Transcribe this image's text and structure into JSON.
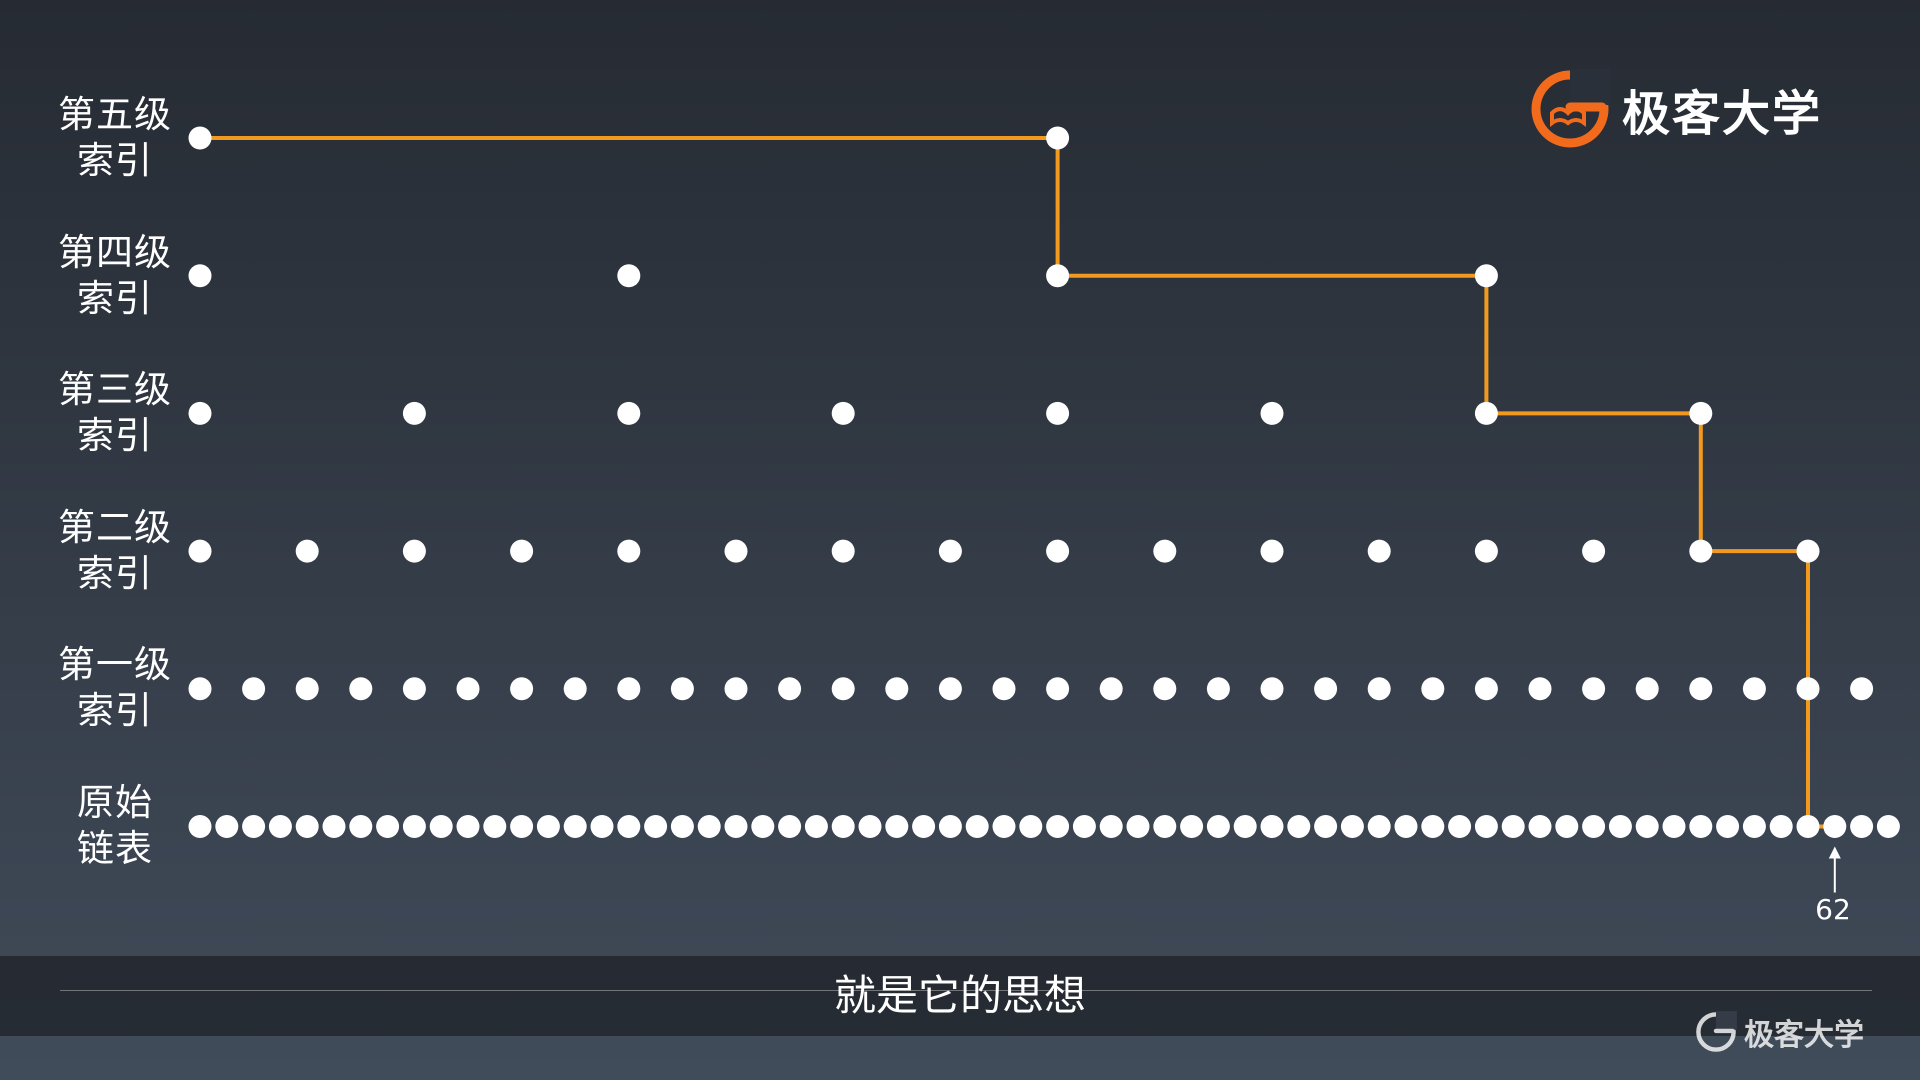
{
  "levels": [
    {
      "id": "l5",
      "line1": "第五级",
      "line2": "索引",
      "step": 16,
      "count": 2
    },
    {
      "id": "l4",
      "line1": "第四级",
      "line2": "索引",
      "step": 8,
      "count": 4
    },
    {
      "id": "l3",
      "line1": "第三级",
      "line2": "索引",
      "step": 4,
      "count": 8
    },
    {
      "id": "l2",
      "line1": "第二级",
      "line2": "索引",
      "step": 2,
      "count": 16
    },
    {
      "id": "l1",
      "line1": "第一级",
      "line2": "索引",
      "step": 1,
      "count": 32
    },
    {
      "id": "raw",
      "line1": "原始",
      "line2": "链表",
      "step": 0.5,
      "count": 64
    }
  ],
  "search_path": [
    {
      "level": 0,
      "index": 0
    },
    {
      "level": 0,
      "index": 16
    },
    {
      "level": 1,
      "index": 16
    },
    {
      "level": 1,
      "index": 24
    },
    {
      "level": 2,
      "index": 24
    },
    {
      "level": 2,
      "index": 28
    },
    {
      "level": 3,
      "index": 28
    },
    {
      "level": 3,
      "index": 30
    },
    {
      "level": 4,
      "index": 30
    },
    {
      "level": 5,
      "index": 30
    },
    {
      "level": 5,
      "index": 30.5
    }
  ],
  "target": {
    "label": "62",
    "index": 30.5
  },
  "subtitle": "就是它的思想",
  "brand": {
    "name": "极客大学",
    "accent": "#f26b1d"
  },
  "watermark": {
    "name": "极客大学"
  },
  "colors": {
    "node": "#ffffff",
    "path": "#f29a1f"
  }
}
